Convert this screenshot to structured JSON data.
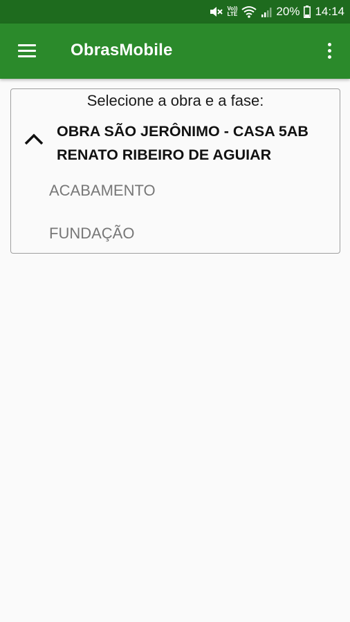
{
  "status_bar": {
    "volte_line1": "Vo))",
    "volte_line2": "LTE",
    "battery": "20%",
    "time": "14:14",
    "icons": [
      "mute-icon",
      "volte-icon",
      "wifi-icon",
      "signal-icon",
      "battery-icon"
    ]
  },
  "app_bar": {
    "title": "ObrasMobile",
    "color": "#2b8a2b",
    "status_color": "#1e6b1e",
    "menu_icon": "hamburger-menu-icon",
    "overflow_icon": "more-vertical-icon"
  },
  "selector": {
    "prompt": "Selecione a obra e a fase:",
    "group": {
      "title_line1": "OBRA SÃO JERÔNIMO - CASA 5AB",
      "title_line2": "RENATO RIBEIRO DE AGUIAR",
      "expanded": true,
      "phases": [
        {
          "label": "ACABAMENTO"
        },
        {
          "label": "FUNDAÇÃO"
        }
      ]
    }
  }
}
